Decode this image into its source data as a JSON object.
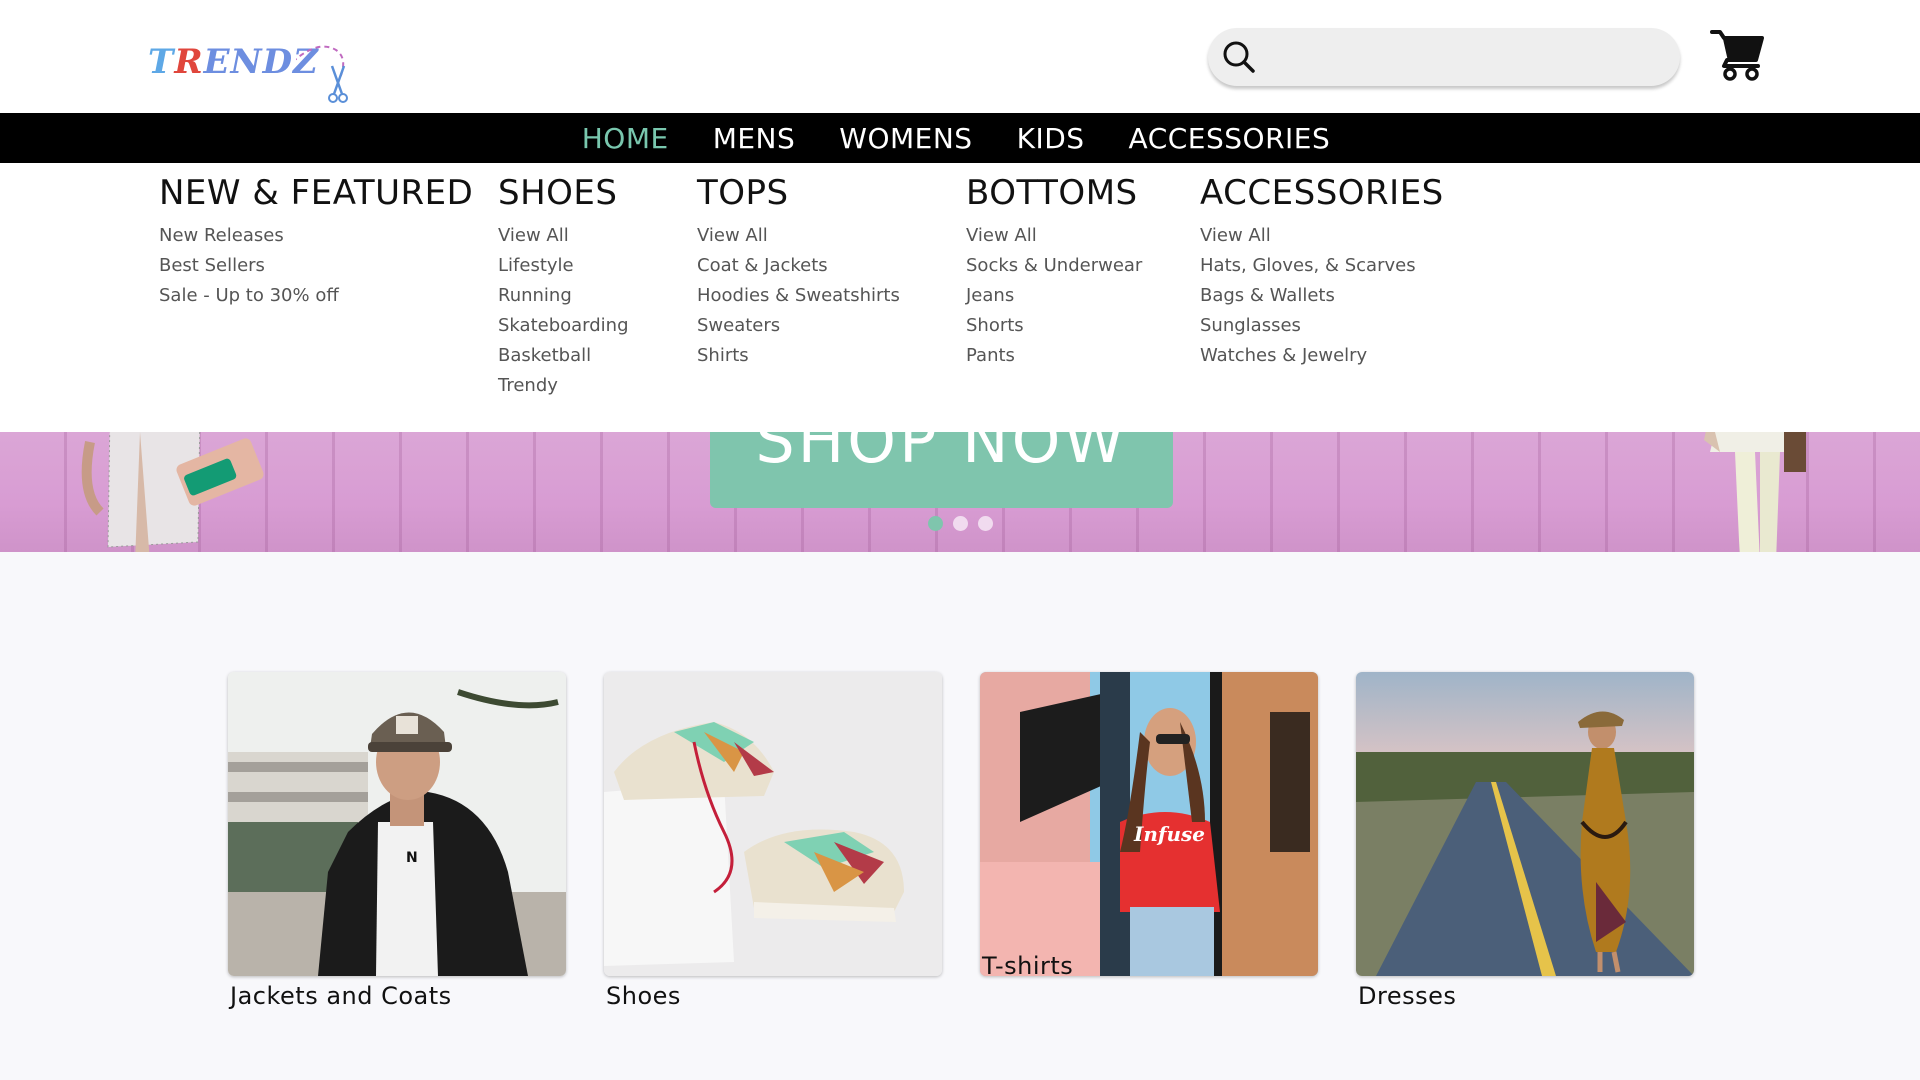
{
  "header": {
    "logo_text": [
      "T",
      "R",
      "ENDZ"
    ],
    "search": {
      "placeholder": "",
      "value": ""
    },
    "cart_icon": "cart-icon"
  },
  "nav": {
    "items": [
      {
        "label": "HOME",
        "active": true
      },
      {
        "label": "MENS",
        "active": false
      },
      {
        "label": "WOMENS",
        "active": false
      },
      {
        "label": "KIDS",
        "active": false
      },
      {
        "label": "ACCESSORIES",
        "active": false
      }
    ],
    "active_color": "#79c7ae"
  },
  "mega_menu": {
    "columns": [
      {
        "title": "NEW & FEATURED",
        "links": [
          "New Releases",
          "Best Sellers",
          "Sale - Up to 30% off"
        ]
      },
      {
        "title": "SHOES",
        "links": [
          "View All",
          "Lifestyle",
          "Running",
          "Skateboarding",
          "Basketball",
          "Trendy"
        ]
      },
      {
        "title": "TOPS",
        "links": [
          "View All",
          "Coat & Jackets",
          "Hoodies & Sweatshirts",
          "Sweaters",
          "Shirts"
        ]
      },
      {
        "title": "BOTTOMS",
        "links": [
          "View All",
          "Socks & Underwear",
          "Jeans",
          "Shorts",
          "Pants"
        ]
      },
      {
        "title": "ACCESSORIES",
        "links": [
          "View All",
          "Hats, Gloves, & Scarves",
          "Bags & Wallets",
          "Sunglasses",
          "Watches & Jewelry"
        ]
      }
    ]
  },
  "hero": {
    "button_label": "SHOP NOW",
    "button_color": "#7fc5ad",
    "slides": 3,
    "active_slide": 1
  },
  "categories": [
    {
      "label": "Jackets and Coats",
      "image": "man-leather-jacket-photo"
    },
    {
      "label": "Shoes",
      "image": "sneakers-photo"
    },
    {
      "label": "T-shirts",
      "image": "woman-red-tshirt-photo"
    },
    {
      "label": "Dresses",
      "image": "woman-dress-road-photo"
    }
  ],
  "embedded_text": {
    "tshirt_print": "Infuse"
  }
}
